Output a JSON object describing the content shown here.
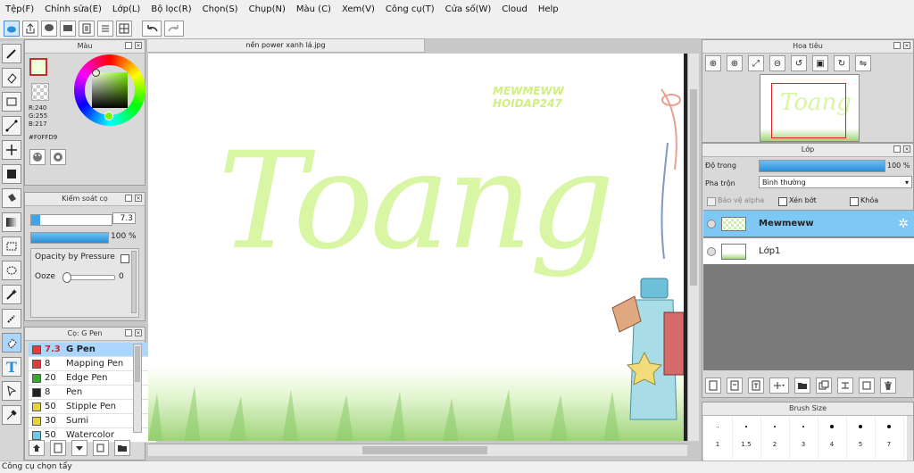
{
  "menu": [
    "Tệp(F)",
    "Chỉnh sửa(E)",
    "Lớp(L)",
    "Bộ lọc(R)",
    "Chọn(S)",
    "Chụp(N)",
    "Màu (C)",
    "Xem(V)",
    "Công cụ(T)",
    "Cửa số(W)",
    "Cloud",
    "Help"
  ],
  "colors": {
    "brand": "#2a8fd8",
    "accent_blue": "#41a4e8",
    "layer_selected": "#7ec8f6",
    "text_lettering": "#d8f6a4"
  },
  "color_panel": {
    "title": "Màu",
    "r": "R:240",
    "g": "G:255",
    "b": "B:217",
    "hex": "#F0FFD9"
  },
  "brush_control": {
    "title": "Kiểm soát cọ",
    "size_value": "7.3",
    "opacity_value": "100 %",
    "opacity_pressure_label": "Opacity by Pressure",
    "ooze_label": "Ooze",
    "ooze_value": "0"
  },
  "brush_list": {
    "title": "Cọ: G Pen",
    "items": [
      {
        "size": "7.3",
        "name": "G Pen",
        "color": "#e33b3b",
        "selected": true
      },
      {
        "size": "8",
        "name": "Mapping Pen",
        "color": "#e33b3b"
      },
      {
        "size": "20",
        "name": "Edge Pen",
        "color": "#33aa33"
      },
      {
        "size": "8",
        "name": "Pen",
        "color": "#222222"
      },
      {
        "size": "50",
        "name": "Stipple Pen",
        "color": "#e8d43a"
      },
      {
        "size": "30",
        "name": "Sumi",
        "color": "#e8d43a"
      },
      {
        "size": "50",
        "name": "Watercolor",
        "color": "#6fc7e8"
      }
    ]
  },
  "canvas": {
    "tab_title": "nền power xanh lá.jpg",
    "watermark_line1": "MEWMEWW",
    "watermark_line2": "HOIDAP247",
    "lettering": "Toang"
  },
  "navigator": {
    "title": "Hoa tiêu",
    "thumb_text": "Toang"
  },
  "layers": {
    "title": "Lớp",
    "opacity_label": "Độ trong",
    "opacity_value": "100 %",
    "blend_label": "Pha trộn",
    "blend_value": "Bình thường",
    "protect_alpha": "Bảo vệ alpha",
    "clipping": "Xén bớt",
    "lock": "Khóa",
    "items": [
      {
        "name": "Mewmeww",
        "selected": true
      },
      {
        "name": "Lớp1",
        "selected": false
      }
    ]
  },
  "brush_size": {
    "title": "Brush Size",
    "sizes": [
      "1",
      "1.5",
      "2",
      "3",
      "4",
      "5",
      "7"
    ]
  },
  "status_bar": "Công cụ chọn tẩy"
}
